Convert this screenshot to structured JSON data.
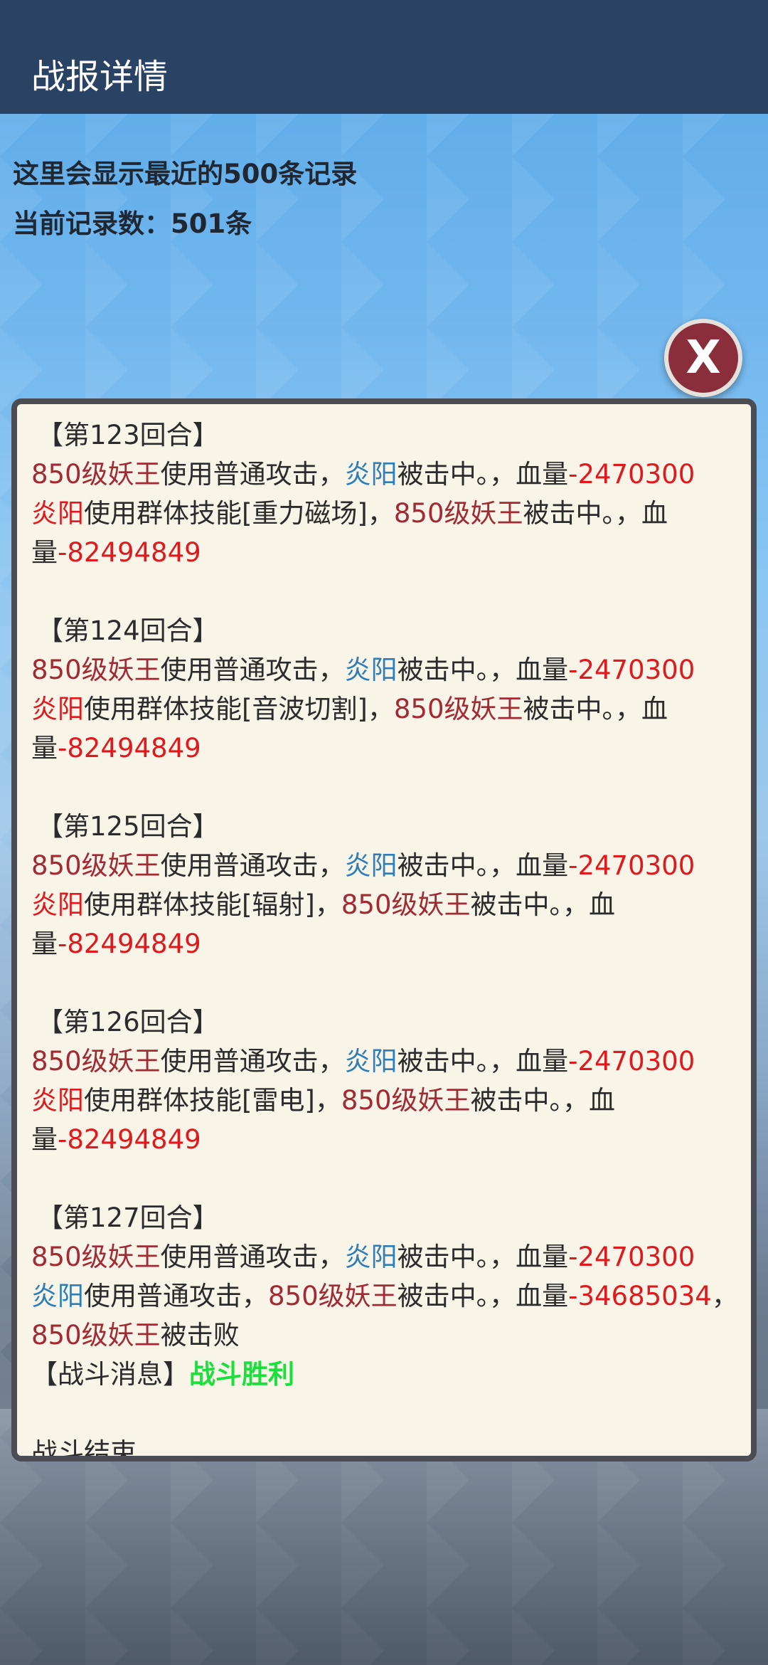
{
  "header": {
    "title": "战报详情"
  },
  "info": {
    "line1": "这里会显示最近的500条记录",
    "line2": "当前记录数：501条"
  },
  "close_button": {
    "label": "X"
  },
  "log": {
    "rounds": [
      {
        "title": "【第123回合】",
        "attacker": "850级妖王",
        "a1": "使用普通攻击，",
        "target1": "炎阳",
        "hit1": "被击中。，血量",
        "dmg1": "-2470300",
        "caster": "炎阳",
        "skill": "使用群体技能[重力磁场]，",
        "target2": "850级妖王",
        "hit2": "被击中。，血量",
        "dmg2": "-82494849"
      },
      {
        "title": "【第124回合】",
        "attacker": "850级妖王",
        "a1": "使用普通攻击，",
        "target1": "炎阳",
        "hit1": "被击中。，血量",
        "dmg1": "-2470300",
        "caster": "炎阳",
        "skill": "使用群体技能[音波切割]，",
        "target2": "850级妖王",
        "hit2": "被击中。，血量",
        "dmg2": "-82494849"
      },
      {
        "title": "【第125回合】",
        "attacker": "850级妖王",
        "a1": "使用普通攻击，",
        "target1": "炎阳",
        "hit1": "被击中。，血量",
        "dmg1": "-2470300",
        "caster": "炎阳",
        "skill": "使用群体技能[辐射]，",
        "target2": "850级妖王",
        "hit2": "被击中。，血量",
        "dmg2": "-82494849"
      },
      {
        "title": "【第126回合】",
        "attacker": "850级妖王",
        "a1": "使用普通攻击，",
        "target1": "炎阳",
        "hit1": "被击中。，血量",
        "dmg1": "-2470300",
        "caster": "炎阳",
        "skill": "使用群体技能[雷电]，",
        "target2": "850级妖王",
        "hit2": "被击中。，血量",
        "dmg2": "-82494849"
      }
    ],
    "last_round": {
      "title": "【第127回合】",
      "attacker": "850级妖王",
      "a1": "使用普通攻击，",
      "target1": "炎阳",
      "hit1": "被击中。，血量",
      "dmg1": "-2470300",
      "caster": "炎阳",
      "attack2": "使用普通攻击，",
      "target2": "850级妖王",
      "hit2": "被击中。，血量",
      "dmg2": "-34685034",
      "sep": "，",
      "defeated_name": "850级妖王",
      "defeated": "被击败",
      "msg_label": "【战斗消息】",
      "msg_value": "战斗胜利",
      "end": "战斗结束"
    }
  },
  "colors": {
    "enemy_name": "#a12a34",
    "hero_name": "#2f7db8",
    "damage": "#e0191e",
    "victory": "#19e03a"
  }
}
